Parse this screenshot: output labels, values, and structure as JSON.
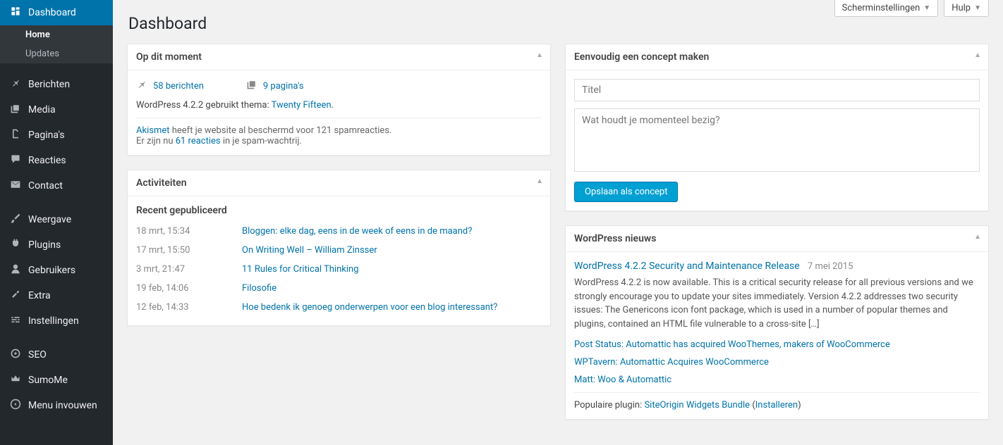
{
  "topbar": {
    "screen_options": "Scherminstellingen",
    "help": "Hulp"
  },
  "sidebar": {
    "dashboard": "Dashboard",
    "home": "Home",
    "updates": "Updates",
    "posts": "Berichten",
    "media": "Media",
    "pages": "Pagina's",
    "comments": "Reacties",
    "contact": "Contact",
    "appearance": "Weergave",
    "plugins": "Plugins",
    "users": "Gebruikers",
    "tools": "Extra",
    "settings": "Instellingen",
    "seo": "SEO",
    "sumome": "SumoMe",
    "collapse": "Menu invouwen"
  },
  "page": {
    "title": "Dashboard"
  },
  "glance": {
    "title": "Op dit moment",
    "posts": "58 berichten",
    "pages": "9 pagina's",
    "version_prefix": "WordPress 4.2.2 gebruikt thema: ",
    "theme": "Twenty Fifteen",
    "akismet_link": "Akismet",
    "akismet_text": " heeft je website al beschermd voor 121 spamreacties.",
    "spam_prefix": "Er zijn nu ",
    "spam_link": "61 reacties",
    "spam_suffix": " in je spam-wachtrij."
  },
  "activity": {
    "title": "Activiteiten",
    "recent": "Recent gepubliceerd",
    "items": [
      {
        "date": "18 mrt, 15:34",
        "title": "Bloggen: elke dag, eens in de week of eens in de maand?"
      },
      {
        "date": "17 mrt, 15:50",
        "title": "On Writing Well – William Zinsser"
      },
      {
        "date": "3 mrt, 21:47",
        "title": "11 Rules for Critical Thinking"
      },
      {
        "date": "19 feb, 14:06",
        "title": "Filosofie"
      },
      {
        "date": "12 feb, 14:33",
        "title": "Hoe bedenk ik genoeg onderwerpen voor een blog interessant?"
      }
    ]
  },
  "draft": {
    "title": "Eenvoudig een concept maken",
    "title_placeholder": "Titel",
    "content_placeholder": "Wat houdt je momenteel bezig?",
    "save": "Opslaan als concept"
  },
  "news": {
    "title": "WordPress nieuws",
    "headline": "WordPress 4.2.2 Security and Maintenance Release",
    "date": "7 mei 2015",
    "body": "WordPress 4.2.2 is now available. This is a critical security release for all previous versions and we strongly encourage you to update your sites immediately. Version 4.2.2 addresses two security issues: The Genericons icon font package, which is used in a number of popular themes and plugins, contained an HTML file vulnerable to a cross-site […]",
    "links": [
      "Post Status: Automattic has acquired WooThemes, makers of WooCommerce",
      "WPTavern: Automattic Acquires WooCommerce",
      "Matt: Woo & Automattic"
    ],
    "plugin_prefix": "Populaire plugin: ",
    "plugin_name": "SiteOrigin Widgets Bundle",
    "plugin_install": "Installeren"
  }
}
